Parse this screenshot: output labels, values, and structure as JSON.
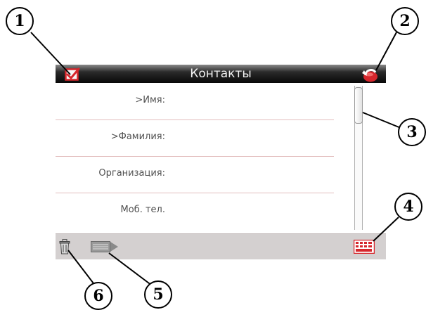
{
  "header": {
    "title": "Контакты",
    "check_icon": "checkbox-checked-icon",
    "back_icon": "back-arrow-icon"
  },
  "fields": [
    {
      "label": ">Имя:"
    },
    {
      "label": ">Фамилия:"
    },
    {
      "label": "Организация:"
    },
    {
      "label": "Моб. тел."
    }
  ],
  "toolbar": {
    "delete_icon": "trash-icon",
    "flag_icon": "flag-icon",
    "keyboard_icon": "keyboard-icon"
  },
  "callouts": [
    "1",
    "2",
    "3",
    "4",
    "5",
    "6"
  ],
  "colors": {
    "accent": "#d6262c",
    "toolbar": "#d4d0d0",
    "divider": "#e2bcbc",
    "header": "#0a0a0a"
  }
}
